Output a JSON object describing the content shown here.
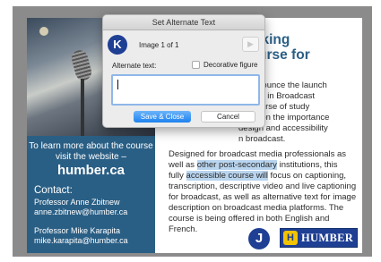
{
  "dialog": {
    "title": "Set Alternate Text",
    "app_icon_letter": "K",
    "image_counter": "Image 1 of 1",
    "next_glyph": "▶",
    "alt_text_label": "Alternate text:",
    "alt_text_value": "",
    "decorative_label": "Decorative figure",
    "decorative_checked": false,
    "save_label": "Save & Close",
    "cancel_label": "Cancel"
  },
  "document": {
    "left_column": {
      "visit_text": "To learn more about the course visit the website –",
      "website": "humber.ca",
      "contact_heading": "Contact:",
      "contacts": [
        {
          "name": "Professor Anne Zbitnew",
          "email": "anne.zbitnew@humber.ca"
        },
        {
          "name": "Professor Mike Karapita",
          "email": "mike.karapita@humber.ca"
        }
      ]
    },
    "headline": {
      "line1": "s Making",
      "line2": "a course for"
    },
    "paragraph1_lines": [
      "to announce the launch",
      "Design in Broadcast",
      "ew course of study",
      "dians on the importance",
      "design and accessibility",
      "n broadcast."
    ],
    "paragraph2": {
      "line1": "Designed for broadcast media professionals as",
      "line2_pre": "well as ",
      "line2_hl": "other post-secondary",
      "line2_post": " institutions, this",
      "line3_pre": "fully ",
      "line3_hl": "accessible course will",
      "line3_post": " focus on captioning,",
      "line4": "transcription, descriptive video and live captioning",
      "line5": "for broadcast, as well as alternative text for image",
      "line6": "description on broadcast media platforms. The",
      "line7": "course is being offered in both English and French."
    },
    "logos": {
      "j_letter": "J",
      "humber_crest": "H",
      "humber_word": "HUMBER"
    }
  },
  "colors": {
    "left_column_bg": "#2a5f85",
    "headline": "#2a5f85",
    "save_button": "#1e82ee",
    "humber_blue": "#1f3f94",
    "highlight": "#b8d4ee"
  }
}
